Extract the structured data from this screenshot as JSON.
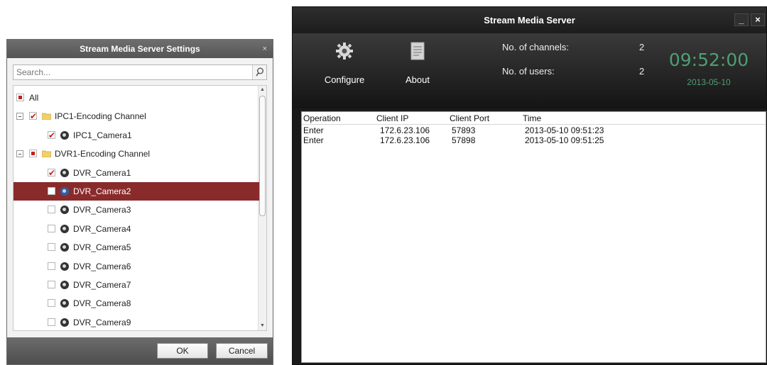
{
  "settings": {
    "title": "Stream Media Server Settings",
    "close_glyph": "×",
    "search_placeholder": "Search...",
    "search_icon": "search-icon",
    "tree": [
      {
        "label": "All",
        "type": "root",
        "check": "partial"
      },
      {
        "label": "IPC1-Encoding Channel",
        "type": "group",
        "check": "checked"
      },
      {
        "label": "IPC1_Camera1",
        "type": "camera",
        "check": "checked"
      },
      {
        "label": "DVR1-Encoding Channel",
        "type": "group",
        "check": "partial"
      },
      {
        "label": "DVR_Camera1",
        "type": "camera",
        "check": "checked"
      },
      {
        "label": "DVR_Camera2",
        "type": "camera",
        "check": "none",
        "selected": true
      },
      {
        "label": "DVR_Camera3",
        "type": "camera",
        "check": "none"
      },
      {
        "label": "DVR_Camera4",
        "type": "camera",
        "check": "none"
      },
      {
        "label": "DVR_Camera5",
        "type": "camera",
        "check": "none"
      },
      {
        "label": "DVR_Camera6",
        "type": "camera",
        "check": "none"
      },
      {
        "label": "DVR_Camera7",
        "type": "camera",
        "check": "none"
      },
      {
        "label": "DVR_Camera8",
        "type": "camera",
        "check": "none"
      },
      {
        "label": "DVR_Camera9",
        "type": "camera",
        "check": "none"
      }
    ],
    "ok_label": "OK",
    "cancel_label": "Cancel"
  },
  "server": {
    "title": "Stream Media Server",
    "minimize_glyph": "_",
    "close_glyph": "×",
    "configure_label": "Configure",
    "about_label": "About",
    "channels_label": "No. of channels:",
    "channels_value": "2",
    "users_label": "No. of users:",
    "users_value": "2",
    "clock_time": "09:52:00",
    "clock_date": "2013-05-10",
    "log_headers": [
      "Operation",
      "Client IP",
      "Client Port",
      "Time"
    ],
    "log_rows": [
      [
        "Enter",
        "172.6.23.106",
        "57893",
        "2013-05-10 09:51:23"
      ],
      [
        "Enter",
        "172.6.23.106",
        "57898",
        "2013-05-10 09:51:25"
      ]
    ]
  },
  "colors": {
    "selection": "#8a2b2b",
    "check_red": "#c0211f",
    "clock_green": "#4e9f74"
  }
}
